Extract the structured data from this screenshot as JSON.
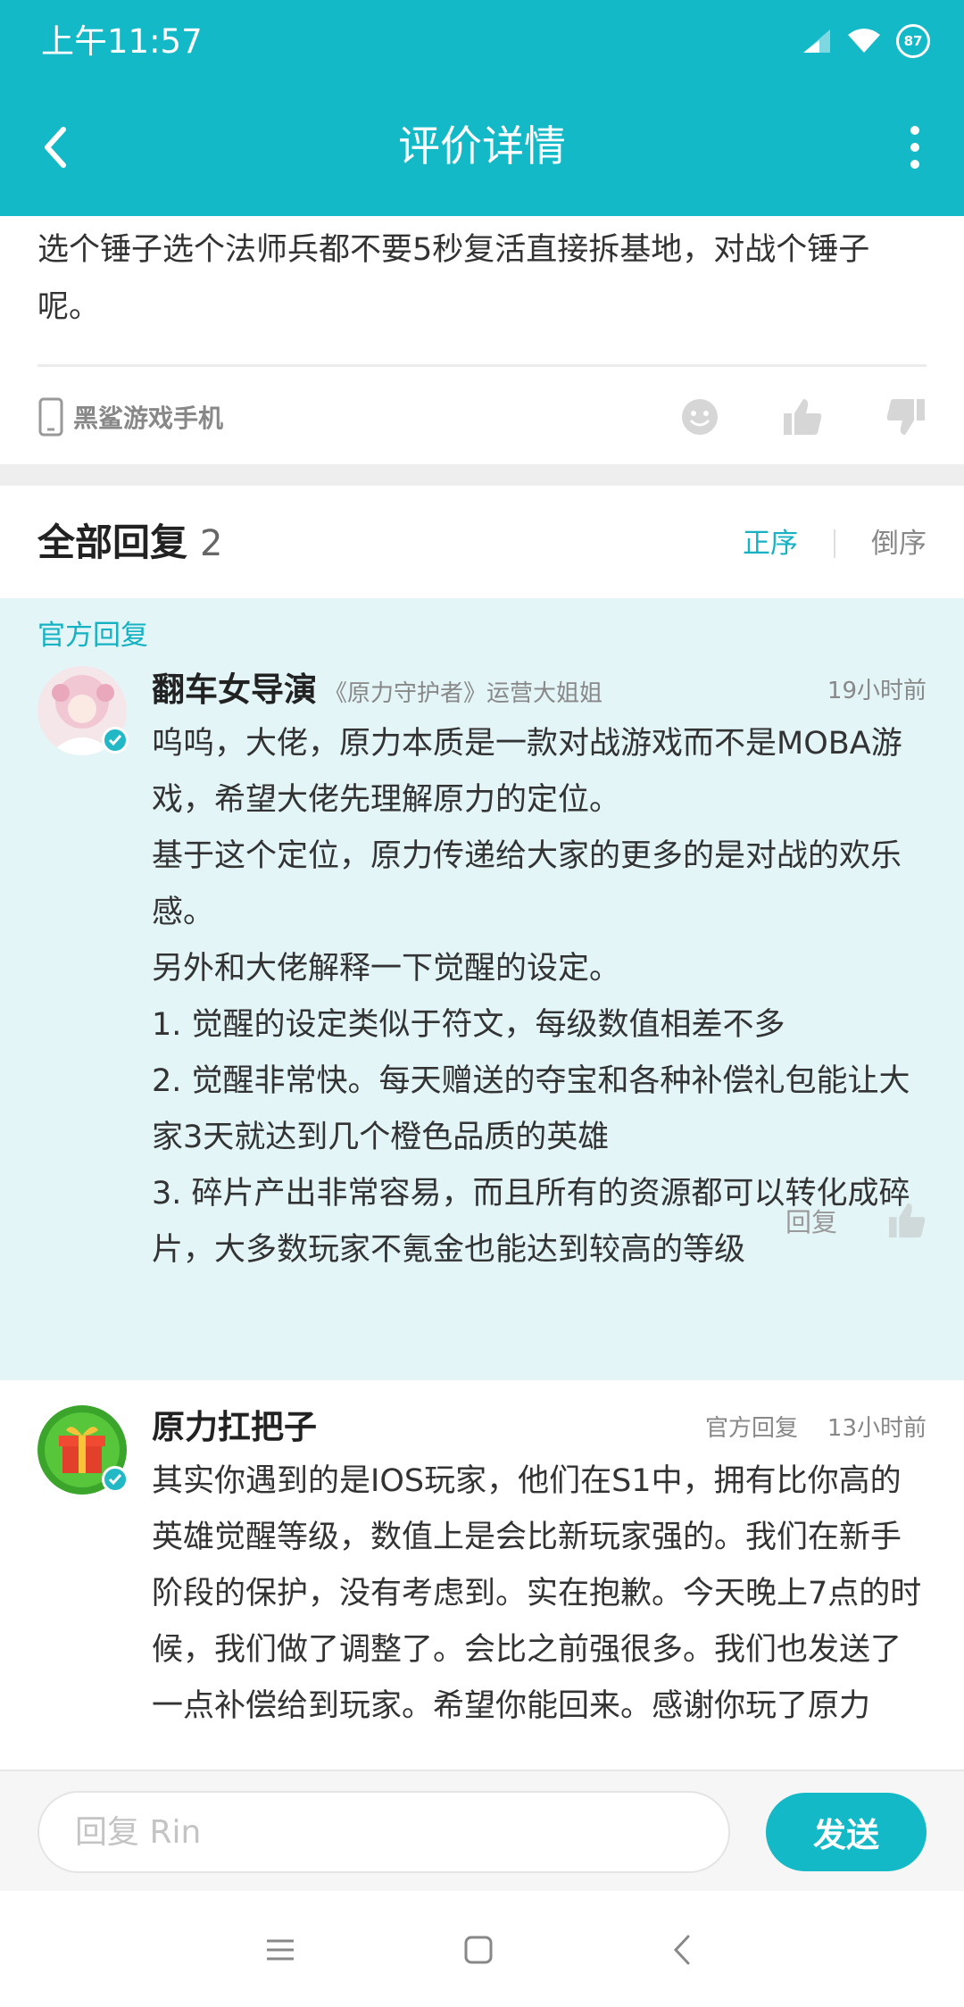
{
  "status_bar": {
    "time": "上午11:57",
    "battery": "87"
  },
  "header": {
    "title": "评价详情"
  },
  "review": {
    "text": "选个锤子选个法师兵都不要5秒复活直接拆基地，对战个锤子呢。",
    "device": "黑鲨游戏手机"
  },
  "replies": {
    "title": "全部回复",
    "count": "2",
    "sort_asc": "正序",
    "sort_desc": "倒序"
  },
  "official_reply": {
    "tag": "官方回复",
    "username": "翻车女导演",
    "user_title": "《原力守护者》运营大姐姐",
    "time": "19小时前",
    "paragraphs": [
      "呜呜，大佬，原力本质是一款对战游戏而不是MOBA游戏，希望大佬先理解原力的定位。",
      "基于这个定位，原力传递给大家的更多的是对战的欢乐感。",
      "另外和大佬解释一下觉醒的设定。",
      "1. 觉醒的设定类似于符文，每级数值相差不多",
      "2. 觉醒非常快。每天赠送的夺宝和各种补偿礼包能让大家3天就达到几个橙色品质的英雄",
      "3. 碎片产出非常容易，而且所有的资源都可以转化成碎片，大多数玩家不氪金也能达到较高的等级"
    ],
    "reply_label": "回复"
  },
  "second_reply": {
    "username": "原力扛把子",
    "official_label": "官方回复",
    "time": "13小时前",
    "text": "其实你遇到的是IOS玩家，他们在S1中，拥有比你高的英雄觉醒等级，数值上是会比新玩家强的。我们在新手阶段的保护，没有考虑到。实在抱歉。今天晚上7点的时候，我们做了调整了。会比之前强很多。我们也发送了一点补偿给到玩家。希望你能回来。感谢你玩了原力"
  },
  "input": {
    "placeholder": "回复 Rin",
    "value": ""
  },
  "send_label": "发送",
  "colors": {
    "accent": "#14b9c8",
    "official_bg": "#e3f5f7"
  }
}
